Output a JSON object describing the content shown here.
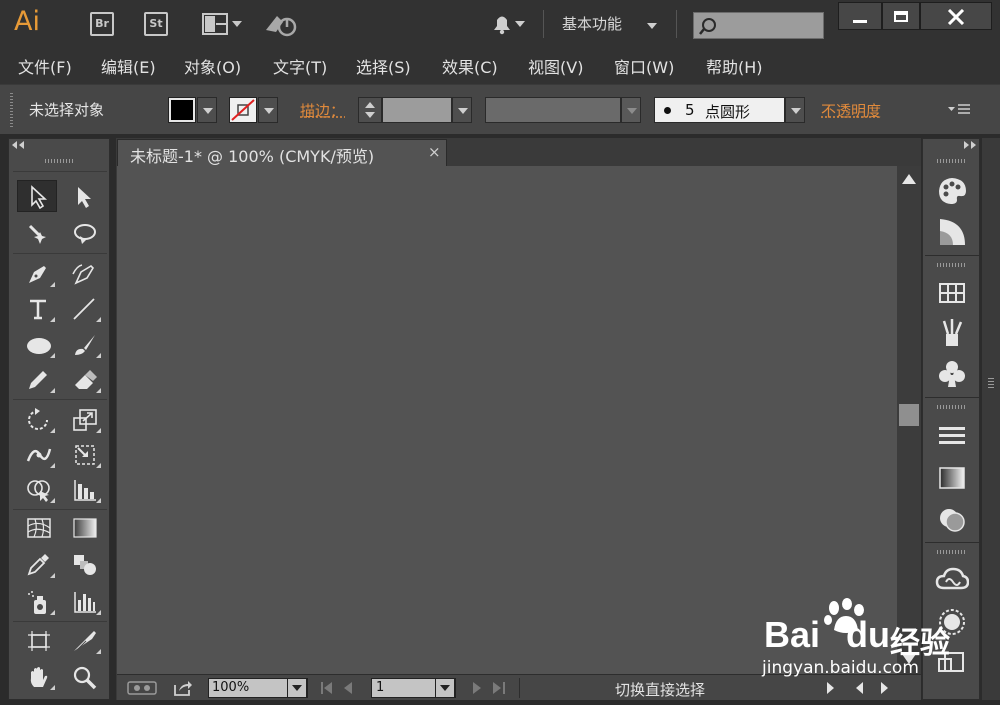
{
  "titlebar": {
    "app_logo": "Ai",
    "bridge_label": "Br",
    "stock_label": "St",
    "workspace": "基本功能"
  },
  "menu": [
    "文件(F)",
    "编辑(E)",
    "对象(O)",
    "文字(T)",
    "选择(S)",
    "效果(C)",
    "视图(V)",
    "窗口(W)",
    "帮助(H)"
  ],
  "control": {
    "selection_state": "未选择对象",
    "fill_color": "#000000",
    "stroke_label": "描边：",
    "brush_value": "5",
    "brush_name": "点圆形",
    "opacity_label": "不透明度"
  },
  "document": {
    "tab_title": "未标题-1* @ 100% (CMYK/预览)",
    "tab_close": "×",
    "zoom": "100%",
    "page": "1",
    "status_text": "切换直接选择"
  },
  "watermark": {
    "brand": "Bai",
    "brand_tail": "经验",
    "url": "jingyan.baidu.com"
  },
  "colors": {
    "accent": "#e08a3c",
    "logo": "#e79a37"
  }
}
